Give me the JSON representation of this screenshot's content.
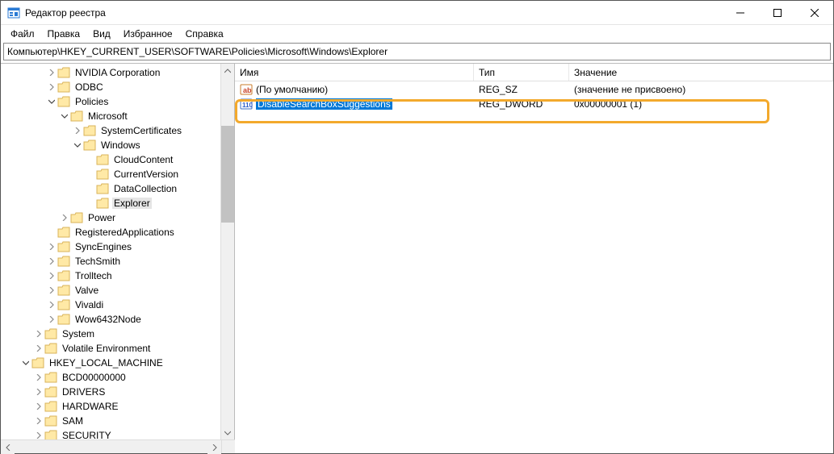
{
  "window": {
    "title": "Редактор реестра"
  },
  "menu": {
    "file": "Файл",
    "edit": "Правка",
    "view": "Вид",
    "favorites": "Избранное",
    "help": "Справка"
  },
  "address": "Компьютер\\HKEY_CURRENT_USER\\SOFTWARE\\Policies\\Microsoft\\Windows\\Explorer",
  "columns": {
    "name": "Имя",
    "type": "Тип",
    "data": "Значение"
  },
  "tree": {
    "nvidia": "NVIDIA Corporation",
    "odbc": "ODBC",
    "policies": "Policies",
    "microsoft": "Microsoft",
    "syscerts": "SystemCertificates",
    "windows": "Windows",
    "cloudcontent": "CloudContent",
    "currentversion": "CurrentVersion",
    "datacollection": "DataCollection",
    "explorer": "Explorer",
    "power": "Power",
    "regapps": "RegisteredApplications",
    "syncengines": "SyncEngines",
    "techsmith": "TechSmith",
    "trolltech": "Trolltech",
    "valve": "Valve",
    "vivaldi": "Vivaldi",
    "wow64": "Wow6432Node",
    "system": "System",
    "volatile": "Volatile Environment",
    "hklm": "HKEY_LOCAL_MACHINE",
    "bcd": "BCD00000000",
    "drivers": "DRIVERS",
    "hardware": "HARDWARE",
    "sam": "SAM",
    "security": "SECURITY"
  },
  "rows": [
    {
      "name": "(По умолчанию)",
      "type": "REG_SZ",
      "data": "(значение не присвоено)",
      "icon": "string",
      "selected": false
    },
    {
      "name": "DisableSearchBoxSuggestions",
      "type": "REG_DWORD",
      "data": "0x00000001 (1)",
      "icon": "dword",
      "selected": true
    }
  ]
}
